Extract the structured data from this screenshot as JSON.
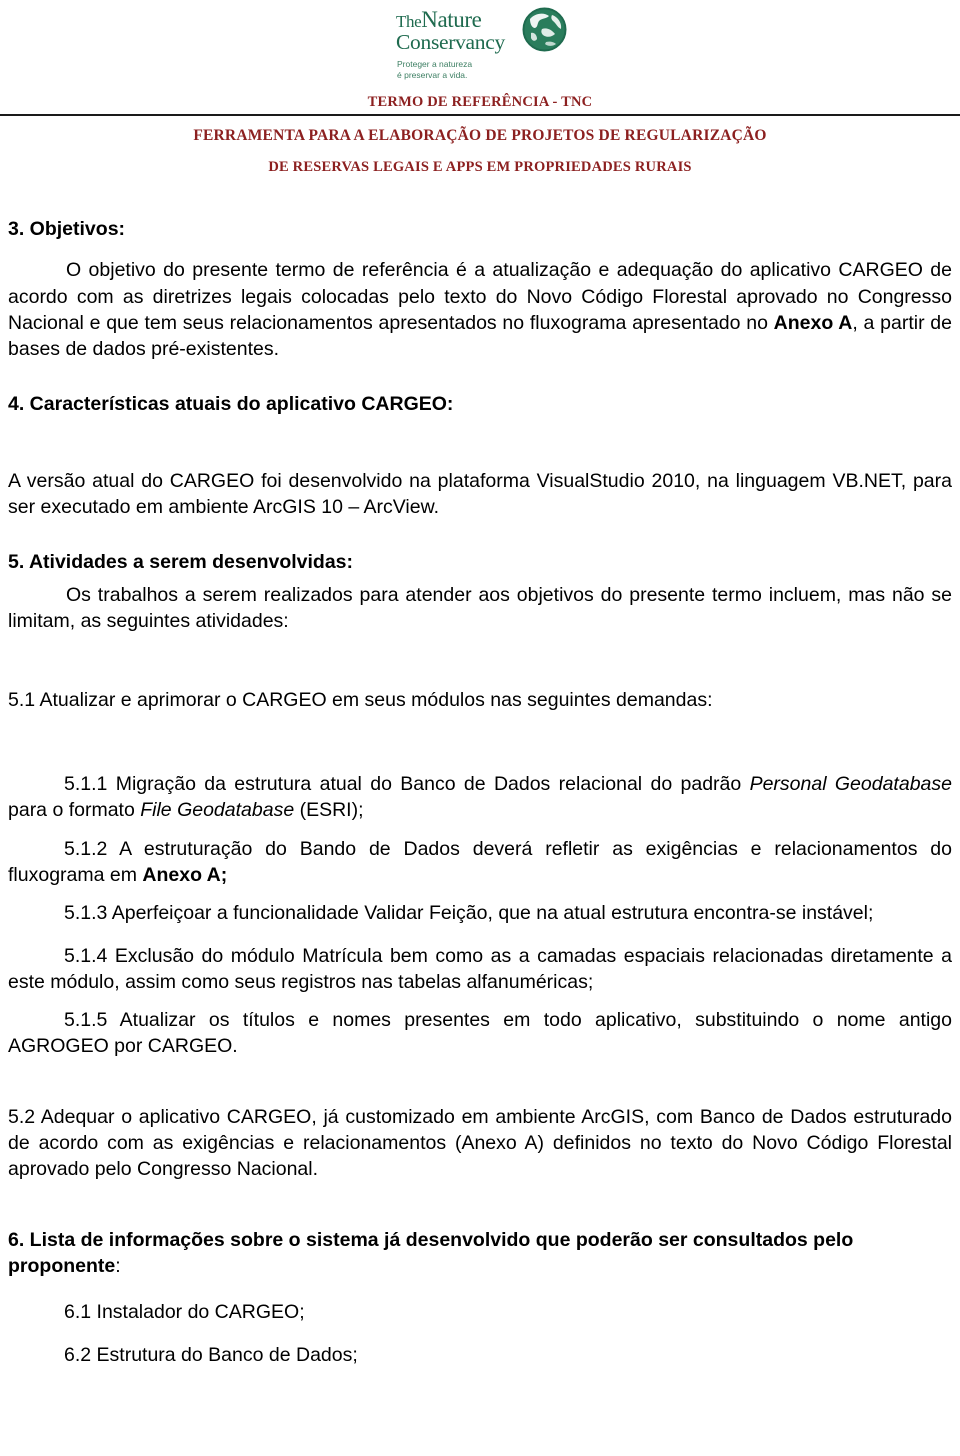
{
  "logo": {
    "the": "The",
    "nature": "Nature",
    "conservancy": "Conservancy",
    "tagline_line1": "Proteger a natureza",
    "tagline_line2": "é preservar a vida.",
    "globe_icon": "globe-leaf-icon",
    "green": "#1f6b4f"
  },
  "header": {
    "line1": "TERMO DE REFERÊNCIA - TNC",
    "line2": "FERRAMENTA PARA A ELABORAÇÃO DE PROJETOS DE REGULARIZAÇÃO",
    "line3": "DE RESERVAS LEGAIS E APPS EM PROPRIEDADES RURAIS",
    "accent_color": "#8c2020"
  },
  "sections": {
    "s3_heading": "3. Objetivos:",
    "s3_p1_a": "O objetivo do presente termo de referência é a atualização e adequação do aplicativo CARGEO de acordo com as diretrizes legais colocadas pelo texto do Novo Código Florestal aprovado no Congresso Nacional e que tem seus relacionamentos apresentados no fluxograma apresentado no ",
    "s3_p1_bold": "Anexo A",
    "s3_p1_b": ", a partir de bases de dados pré-existentes.",
    "s4_heading": "4. Características atuais do aplicativo CARGEO:",
    "s4_p1": "A versão atual do CARGEO foi desenvolvido na plataforma VisualStudio 2010, na linguagem VB.NET, para ser executado em ambiente ArcGIS 10 – ArcView.",
    "s5_heading": "5. Atividades a serem desenvolvidas:",
    "s5_p1": "Os trabalhos a serem realizados para atender aos objetivos do presente termo incluem, mas não se limitam, as seguintes atividades:",
    "s51": "5.1 Atualizar e aprimorar o CARGEO em seus módulos nas seguintes demandas:",
    "s511_a": "5.1.1 Migração da estrutura atual do Banco de Dados relacional do padrão ",
    "s511_i1": "Personal Geodatabase",
    "s511_b": " para o formato ",
    "s511_i2": "File Geodatabase",
    "s511_c": " (ESRI);",
    "s512_a": "5.1.2 A estruturação do Bando de Dados deverá refletir as exigências e relacionamentos do fluxograma em ",
    "s512_bold": "Anexo A;",
    "s513": "5.1.3 Aperfeiçoar a funcionalidade Validar Feição, que na atual estrutura encontra-se instável;",
    "s514": "5.1.4 Exclusão do módulo Matrícula bem como as a camadas espaciais relacionadas diretamente a este módulo, assim como seus registros nas tabelas alfanuméricas;",
    "s515": "5.1.5 Atualizar os títulos e nomes presentes em todo aplicativo, substituindo o nome antigo AGROGEO por CARGEO.",
    "s52": "5.2 Adequar o aplicativo CARGEO, já customizado em ambiente ArcGIS, com Banco de Dados estruturado de acordo com as exigências e relacionamentos (Anexo A) definidos no texto do Novo Código Florestal aprovado pelo Congresso Nacional.",
    "s6_heading_bold": "6. Lista de informações sobre o sistema já desenvolvido que poderão ser consultados pelo proponente",
    "s6_heading_tail": ":",
    "s61": "6.1 Instalador do CARGEO;",
    "s62": "6.2 Estrutura do Banco de Dados;"
  }
}
